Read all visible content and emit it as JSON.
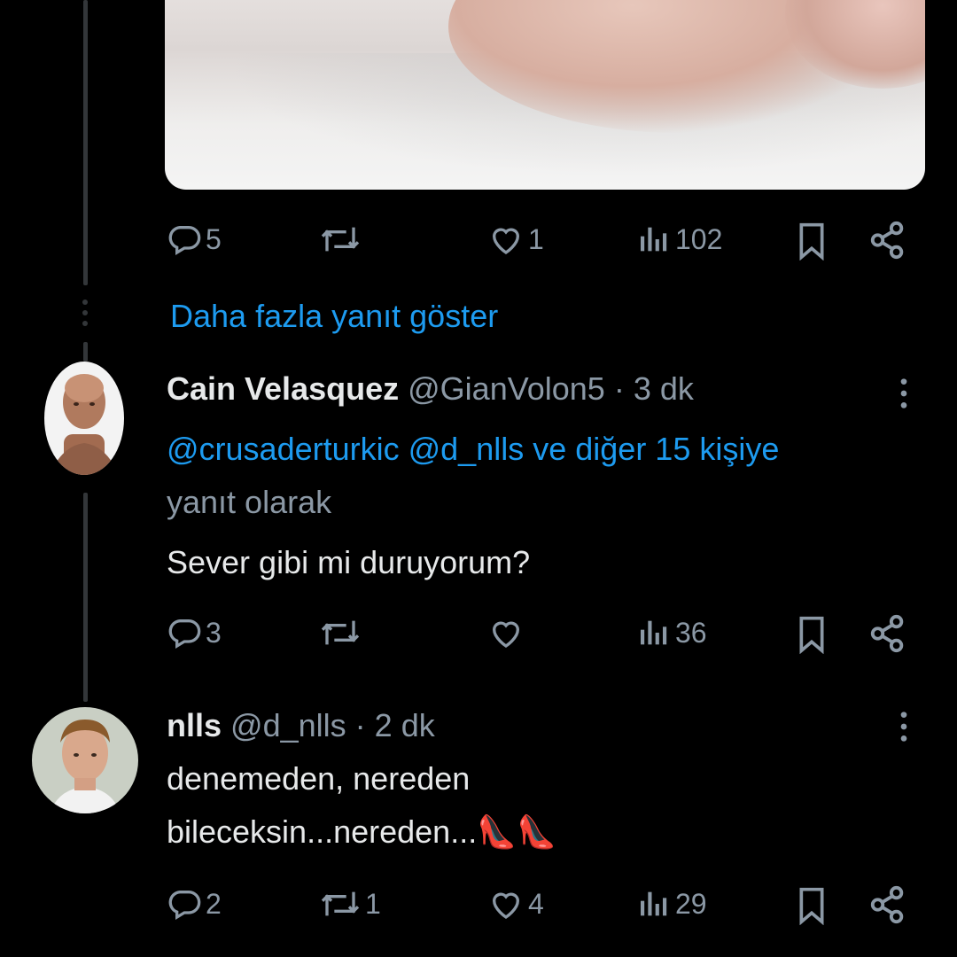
{
  "post1": {
    "replies": "5",
    "reposts": "",
    "likes": "1",
    "views": "102"
  },
  "show_more": "Daha fazla yanıt göster",
  "post2": {
    "name": "Cain Velasquez",
    "handle": "@GianVolon5",
    "separator": "·",
    "time": "3 dk",
    "reply_mentions": "@crusaderturkic @d_nlls ve diğer 15 kişiye",
    "reply_suffix": "yanıt olarak",
    "text": "Sever gibi mi duruyorum?",
    "replies": "3",
    "reposts": "",
    "likes": "",
    "views": "36"
  },
  "post3": {
    "name": "nlls",
    "handle": "@d_nlls",
    "separator": "·",
    "time": "2 dk",
    "text_line1": "denemeden, nereden",
    "text_line2": "bileceksin...nereden...",
    "emoji": "👠👠",
    "replies": "2",
    "reposts": "1",
    "likes": "4",
    "views": "29"
  },
  "colors": {
    "background": "#000000",
    "text": "#e7e9ea",
    "muted": "#8b98a5",
    "link": "#1d9bf0",
    "thread_line": "#333639"
  }
}
